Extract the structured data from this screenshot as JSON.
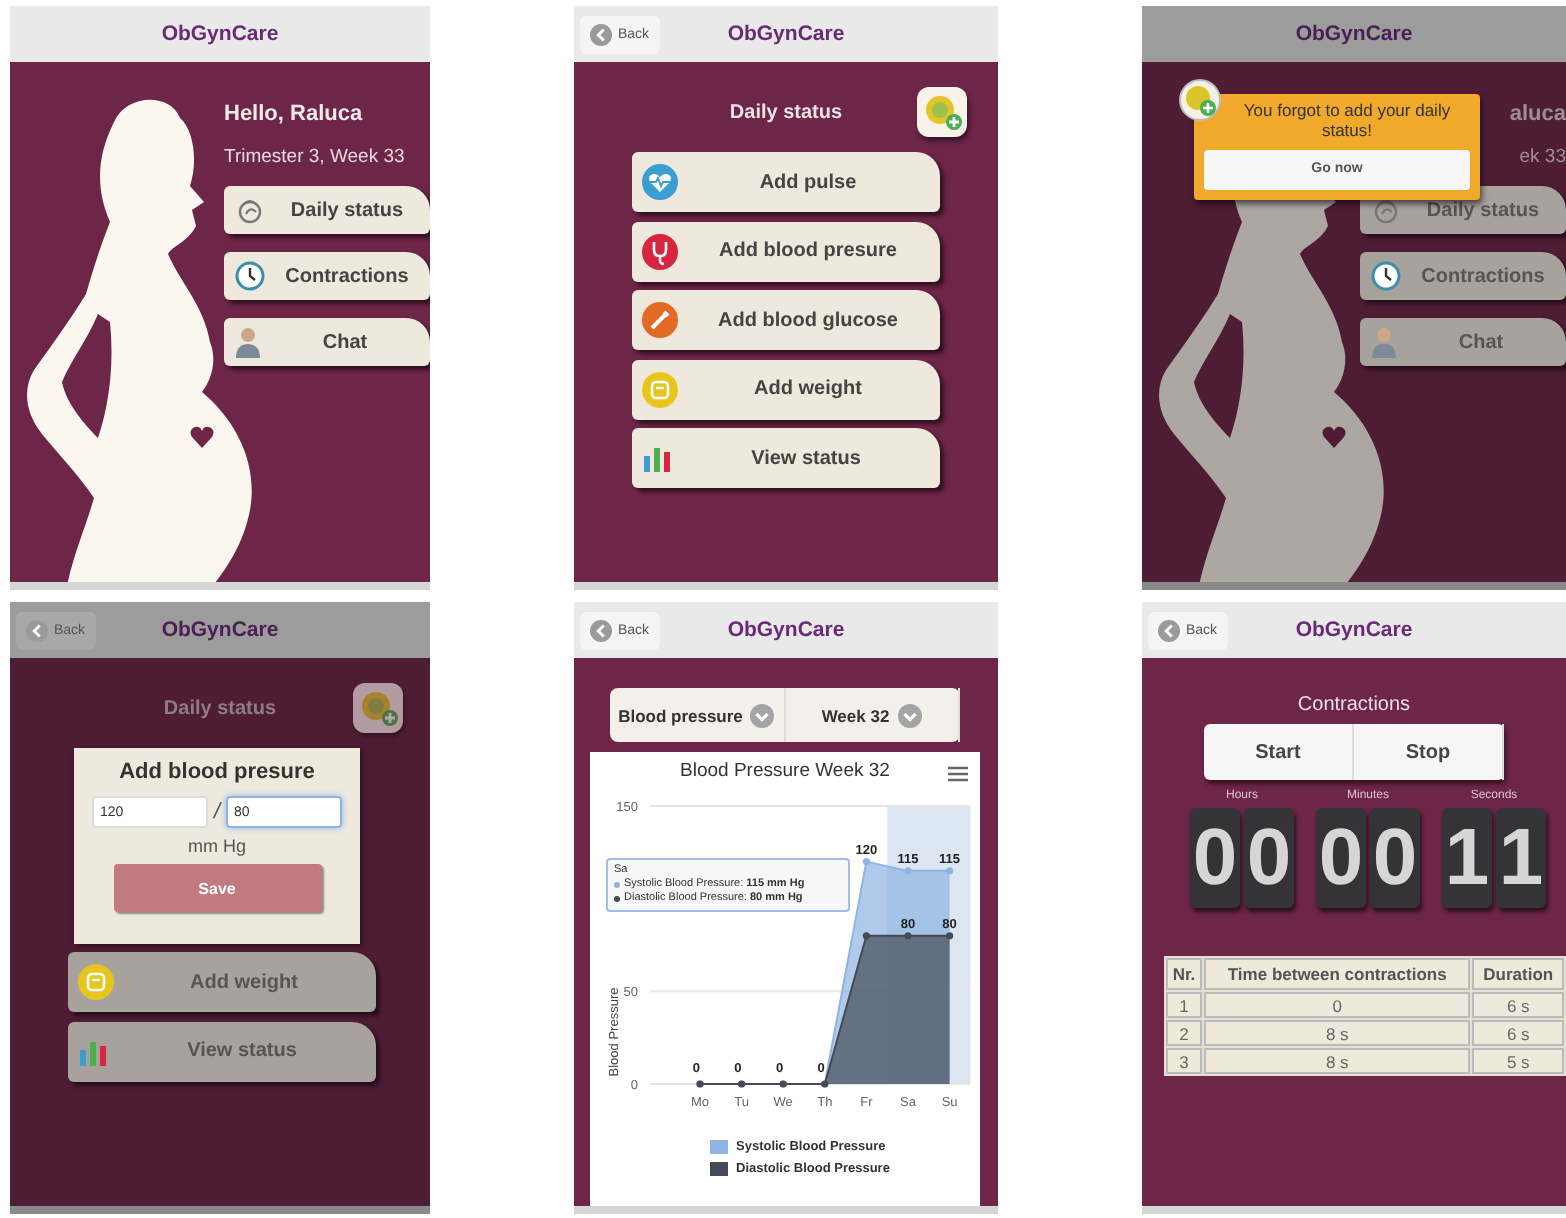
{
  "screens": [
    {
      "kind": "home",
      "header": {
        "title": "ObGynCare"
      },
      "dimmed": false,
      "greeting": "Hello, Raluca",
      "subtitle": "Trimester 3, Week 33",
      "buttons": [
        {
          "label": "Daily status",
          "kind": "status"
        },
        {
          "label": "Contractions",
          "kind": "clock"
        },
        {
          "label": "Chat",
          "kind": "person"
        }
      ]
    },
    {
      "kind": "daily",
      "header": {
        "back": "Back",
        "title": "ObGynCare"
      },
      "dimmed": false,
      "title": "Daily status",
      "buttons": [
        {
          "label": "Add pulse",
          "kind": "pulse",
          "color": "#3a9fd0"
        },
        {
          "label": "Add blood presure",
          "kind": "pressure",
          "color": "#d8253f"
        },
        {
          "label": "Add blood glucose",
          "kind": "glucose",
          "color": "#e26a24"
        },
        {
          "label": "Add weight",
          "kind": "weight",
          "color": "#e8c51c"
        },
        {
          "label": "View status",
          "kind": "chart"
        }
      ]
    },
    {
      "kind": "home",
      "header": {
        "title": "ObGynCare"
      },
      "dimmed": true,
      "greeting": "aluca",
      "subtitle": "ek 33",
      "buttons": [
        {
          "label": "Daily status",
          "kind": "status"
        },
        {
          "label": "Contractions",
          "kind": "clock"
        },
        {
          "label": "Chat",
          "kind": "person"
        }
      ],
      "popup": {
        "message": "You forgot to add your daily status!",
        "button": "Go now"
      }
    },
    {
      "kind": "daily",
      "header": {
        "back": "Back",
        "title": "ObGynCare"
      },
      "dimmed": true,
      "title": "Daily status",
      "dialog": {
        "title": "Add blood presure",
        "fields": [
          {
            "value": "120",
            "focused": false
          },
          {
            "value": "80",
            "focused": true
          }
        ],
        "separator": "/",
        "unit": "mm Hg",
        "button": "Save"
      },
      "buttons": [
        {
          "label": "Add weight",
          "kind": "weight",
          "color": "#e8c51c"
        },
        {
          "label": "View status",
          "kind": "chart"
        }
      ]
    },
    {
      "kind": "chart",
      "header": {
        "back": "Back",
        "title": "ObGynCare"
      },
      "dropdowns": [
        {
          "label": "Blood pressure"
        },
        {
          "label": "Week 32"
        }
      ],
      "chart_data": {
        "type": "area",
        "title": "Blood Pressure Week 32",
        "ylabel": "Blood Pressure",
        "categories": [
          "Mo",
          "Tu",
          "We",
          "Th",
          "Fr",
          "Sa",
          "Su"
        ],
        "ylim": [
          0,
          150
        ],
        "yticks": [
          0,
          50,
          150
        ],
        "legend": true,
        "series": [
          {
            "name": "Systolic Blood Pressure",
            "color": "#8fb4e3",
            "values": [
              0,
              0,
              0,
              0,
              120,
              115,
              115
            ],
            "value_labels": [
              "0",
              "0",
              "0",
              "0",
              "120",
              "115",
              "115"
            ]
          },
          {
            "name": "Diastolic Blood Pressure",
            "color": "#454b55",
            "values": [
              0,
              0,
              0,
              0,
              80,
              80,
              80
            ],
            "value_labels": [
              null,
              null,
              null,
              null,
              null,
              "80",
              "80"
            ]
          }
        ]
      },
      "hover": [
        false,
        false,
        false,
        false,
        false,
        true,
        false
      ],
      "tooltip": {
        "title": "Sa",
        "lines": [
          "Systolic Blood Pressure: **115 mm Hg**",
          "Diastolic Blood Pressure: **80 mm Hg**"
        ]
      }
    },
    {
      "kind": "timer",
      "header": {
        "back": "Back",
        "title": "ObGynCare"
      },
      "title": "Contractions",
      "buttons": [
        {
          "label": "Start"
        },
        {
          "label": "Stop"
        }
      ],
      "timer": [
        {
          "label": "Hours",
          "digits": [
            "0",
            "0"
          ]
        },
        {
          "label": "Minutes",
          "digits": [
            "0",
            "0"
          ]
        },
        {
          "label": "Seconds",
          "digits": [
            "1",
            "1"
          ]
        }
      ],
      "table": {
        "columns": [
          "Nr.",
          "Time between contractions",
          "Duration"
        ],
        "rows": [
          [
            "1",
            "0",
            "6 s"
          ],
          [
            "2",
            "8 s",
            "6 s"
          ],
          [
            "3",
            "8 s",
            "5 s"
          ]
        ]
      }
    }
  ]
}
